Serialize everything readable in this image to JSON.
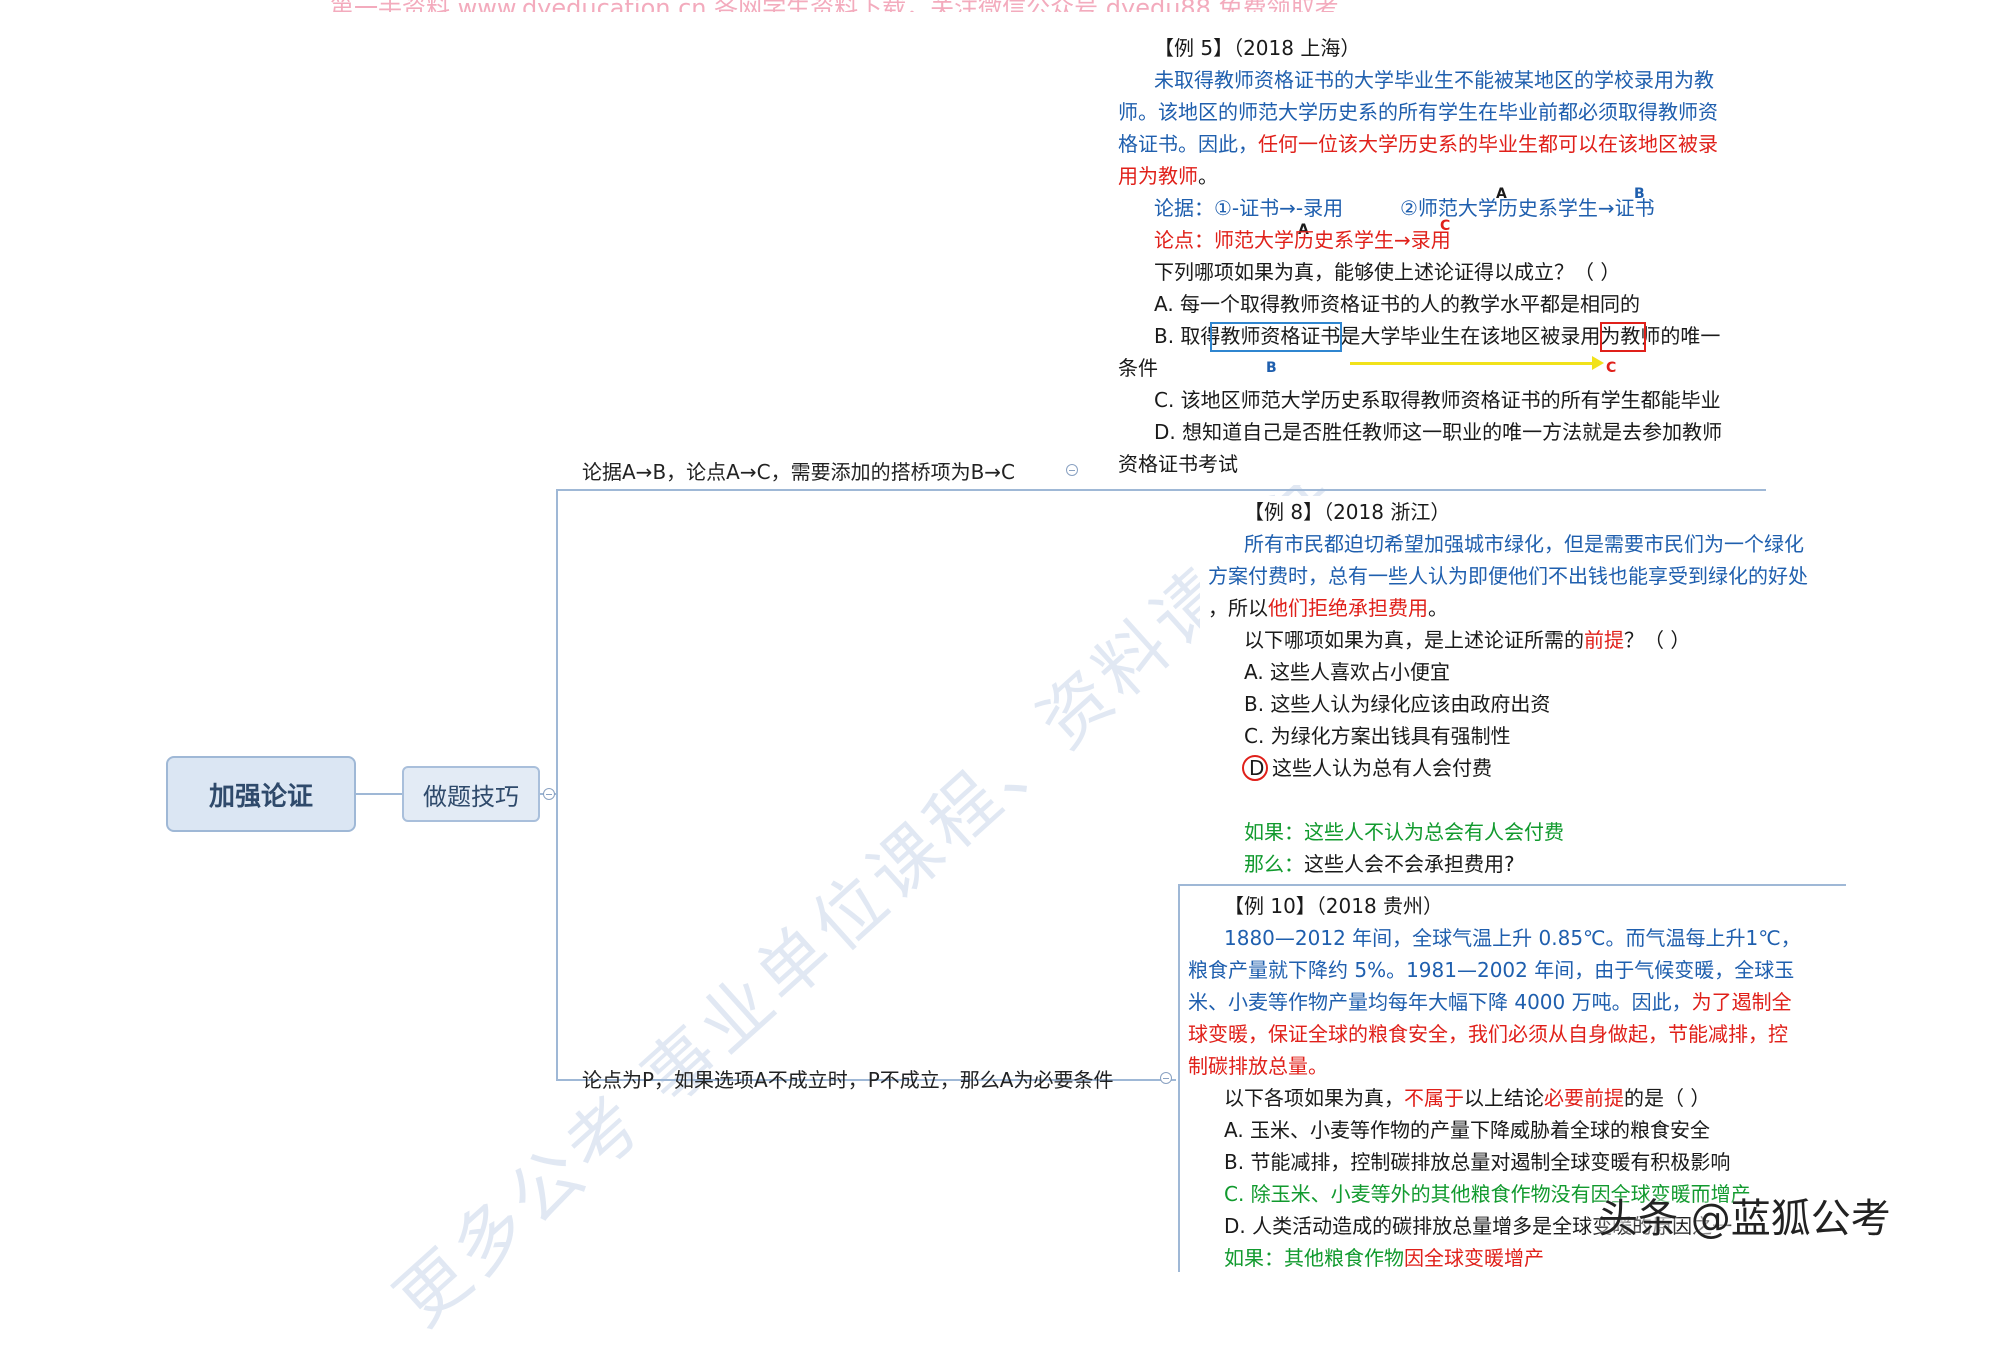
{
  "top_banner": "第一手资料 www.dyeducation.cn 各网学生资料下载，关注微信公众号 dyedu88 免费领取考",
  "watermarks": {
    "main": "更多公考  事业单位课程、资料请关注",
    "top": "考",
    "bottom": "更多公考"
  },
  "mindmap": {
    "root": "加强论证",
    "sub": "做题技巧",
    "branch_top": "论据A→B，论点A→C，需要添加的搭桥项为B→C",
    "branch_bottom": "论点为P，如果选项A不成立时，P不成立，那么A为必要条件"
  },
  "panel1": {
    "title": "【例 5】（2018 上海）",
    "l1": "未取得教师资格证书的大学毕业生不能被某地区的学校录用为教",
    "l2": "师。该地区的师范大学历史系的所有学生在毕业前都必须取得教师资",
    "l3a": "格证书。因此，",
    "l3b": "任何一位该大学历史系的毕业生都可以在该地区被录",
    "l4a": "用为教师",
    "l4b": "。",
    "arg": "论据：①-证书→-录用",
    "arg2": "②师范大学历史系学生→证书",
    "concl": "论点：师范大学历史系学生→录用",
    "q": "下列哪项如果为真，能够使上述论证得以成立？（ ）",
    "a": "A. 每一个取得教师资格证书的人的教学水平都是相同的",
    "b": "B. 取得教师资格证书是大学毕业生在该地区被录用为教师的唯一",
    "b2": "条件",
    "c": "C. 该地区师范大学历史系取得教师资格证书的所有学生都能毕业",
    "d": "D. 想知道自己是否胜任教师这一职业的唯一方法就是去参加教师",
    "d2": "资格证书考试",
    "marks": {
      "A": "A",
      "B": "B",
      "C": "C"
    }
  },
  "panel2": {
    "title": "【例 8】（2018 浙江）",
    "l1": "所有市民都迫切希望加强城市绿化，但是需要市民们为一个绿化",
    "l2": "方案付费时，总有一些人认为即便他们不出钱也能享受到绿化的好处",
    "l3a": "，所以",
    "l3b": "他们拒绝承担费用",
    "l3c": "。",
    "qa": "以下哪项如果为真，是上述论证所需的",
    "qb": "前提",
    "qc": "？（ ）",
    "a": "A. 这些人喜欢占小便宜",
    "b": "B. 这些人认为绿化应该由政府出资",
    "c": "C. 为绿化方案出钱具有强制性",
    "d_letter": "D",
    "d": "这些人认为总有人会付费",
    "if": "如果：这些人不认为总会有人会付费",
    "then_a": "那么：",
    "then_b": "这些人会不会承担费用?"
  },
  "panel3": {
    "title": "【例 10】（2018 贵州）",
    "l1": "1880—2012 年间，全球气温上升 0.85℃。而气温每上升1℃，",
    "l2": "粮食产量就下降约 5%。1981—2002 年间，由于气候变暖，全球玉",
    "l3a": "米、小麦等作物产量均每年大幅下降 4000 万吨。因此，",
    "l3b": "为了遏制全",
    "l4": "球变暖，保证全球的粮食安全，我们必须从自身做起，节能减排，控",
    "l5": "制碳排放总量。",
    "qa": "以下各项如果为真，",
    "qb": "不属于",
    "qc": "以上结论",
    "qd": "必要前提",
    "qe": "的是（ ）",
    "a": "A. 玉米、小麦等作物的产量下降威胁着全球的粮食安全",
    "b": "B. 节能减排，控制碳排放总量对遏制全球变暖有积极影响",
    "c": "C. 除玉米、小麦等外的其他粮食作物没有因全球变暖而增产",
    "d": "D. 人类活动造成的碳排放总量增多是全球变暖的原因之一",
    "if_a": "如果：其他粮食作物",
    "if_b": "因全球变暖增产"
  },
  "brand": "头条 @蓝狐公考"
}
